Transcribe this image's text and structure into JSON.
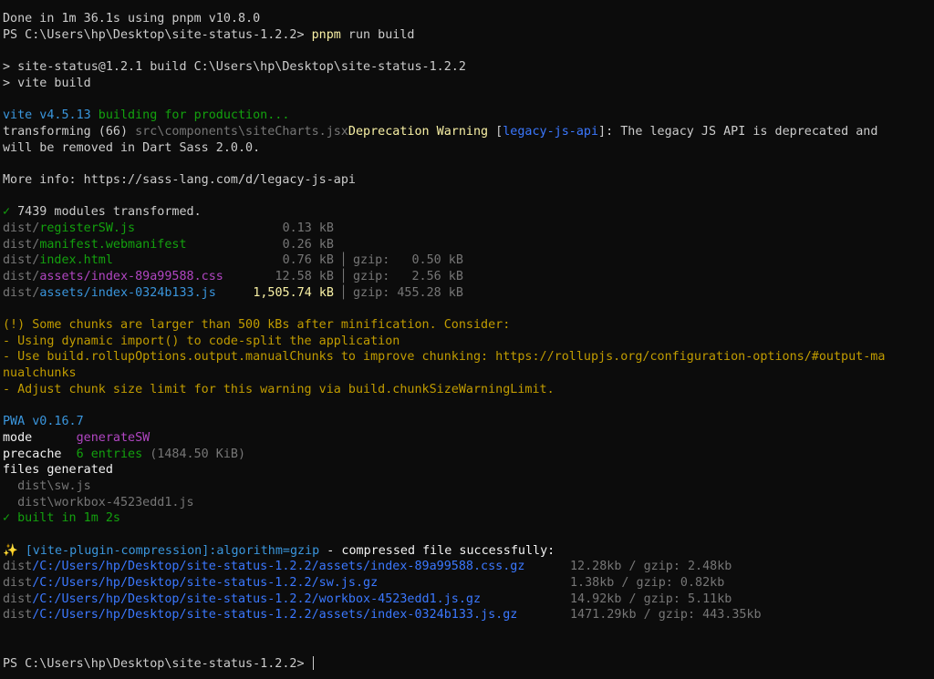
{
  "terminal": {
    "pnpm_done": "Done in 1m 36.1s using pnpm v10.8.0",
    "prompt": "PS C:\\Users\\hp\\Desktop\\site-status-1.2.2> ",
    "cmd_name": "pnpm",
    "cmd_args": " run build",
    "script_line1": "> site-status@1.2.1 build C:\\Users\\hp\\Desktop\\site-status-1.2.2",
    "script_line2": "> vite build",
    "vite_version": "vite v4.5.13",
    "vite_building": " building for production...",
    "transform_prefix": "transforming (66) ",
    "transform_file": "src\\components\\siteCharts.jsx",
    "deprecation_label": "Deprecation Warning",
    "bracket_open": " [",
    "deprecation_tag": "legacy-js-api",
    "deprecation_msg": "]: The legacy JS API is deprecated and",
    "deprecation_msg2": "will be removed in Dart Sass 2.0.0.",
    "more_info": "More info: https://sass-lang.com/d/legacy-js-api",
    "check_mark": "✓",
    "modules_text": " 7439 modules transformed.",
    "dist_prefix": "dist/",
    "gzip_sep": "│",
    "output_files": [
      {
        "name": "registerSW.js",
        "size": "0.13 kB",
        "gzip": ""
      },
      {
        "name": "manifest.webmanifest",
        "size": "0.26 kB",
        "gzip": ""
      },
      {
        "name": "index.html",
        "size": "0.76 kB",
        "gzip": "gzip:   0.50 kB"
      },
      {
        "name": "assets/index-89a99588.css",
        "size": "12.58 kB",
        "gzip": "gzip:   2.56 kB"
      },
      {
        "name": "assets/index-0324b133.js",
        "size": "1,505.74 kB",
        "gzip": "gzip: 455.28 kB"
      }
    ],
    "warn_lines": [
      "(!) Some chunks are larger than 500 kBs after minification. Consider:",
      "- Using dynamic import() to code-split the application",
      "- Use build.rollupOptions.output.manualChunks to improve chunking: https://rollupjs.org/configuration-options/#output-ma",
      "nualchunks",
      "- Adjust chunk size limit for this warning via build.chunkSizeWarningLimit."
    ],
    "pwa_title": "PWA v0.16.7",
    "mode_label": "mode      ",
    "mode_value": "generateSW",
    "precache_label": "precache  ",
    "precache_value": "6 entries",
    "precache_size": " (1484.50 KiB)",
    "files_generated": "files generated",
    "gen_file1": "  dist\\sw.js",
    "gen_file2": "  dist\\workbox-4523edd1.js",
    "built_text": " built in 1m 2s",
    "sparkle": "✨",
    "compression_plugin": " [vite-plugin-compression]:algorithm=gzip",
    "compression_msg": " - compressed file successfully:",
    "dist_label": "dist",
    "compressed_files": [
      {
        "path": "/C:/Users/hp/Desktop/site-status-1.2.2/assets/index-89a99588.css.gz",
        "size": "12.28kb / gzip: 2.48kb"
      },
      {
        "path": "/C:/Users/hp/Desktop/site-status-1.2.2/sw.js.gz",
        "size": "1.38kb / gzip: 0.82kb"
      },
      {
        "path": "/C:/Users/hp/Desktop/site-status-1.2.2/workbox-4523edd1.js.gz",
        "size": "14.92kb / gzip: 5.11kb"
      },
      {
        "path": "/C:/Users/hp/Desktop/site-status-1.2.2/assets/index-0324b133.js.gz",
        "size": "1471.29kb / gzip: 443.35kb"
      }
    ],
    "final_prompt": "PS C:\\Users\\hp\\Desktop\\site-status-1.2.2> "
  }
}
